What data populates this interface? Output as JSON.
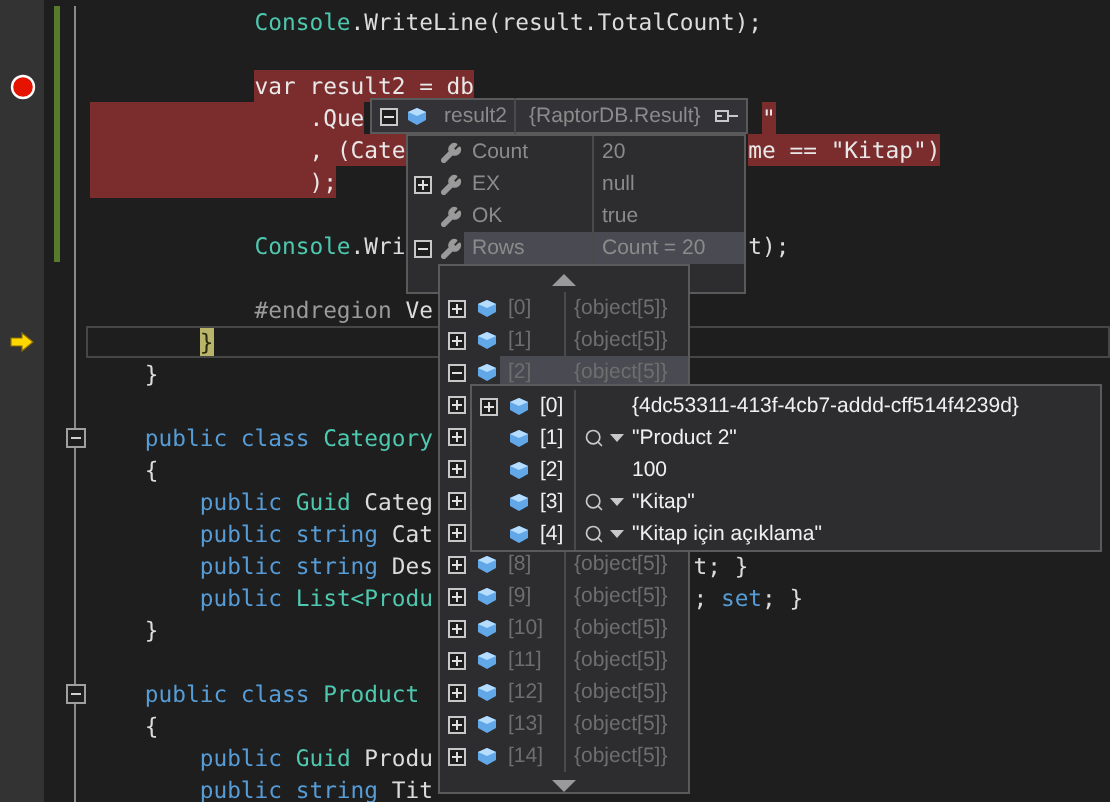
{
  "editor": {
    "lines": [
      {
        "kind": "code",
        "tokens": [
          {
            "kind": "type",
            "text": "            Console"
          },
          {
            "kind": "plain",
            "text": ".WriteLine(result.TotalCount);"
          }
        ],
        "changed": true,
        "highlighted": false
      },
      {
        "kind": "code",
        "changed": true
      },
      {
        "kind": "breakpoint",
        "tokens": [
          {
            "kind": "keyword",
            "text": "            var"
          },
          {
            "kind": "plain",
            "text": " result2 = db"
          }
        ],
        "changed": true,
        "highlighted": true
      },
      {
        "kind": "code",
        "tokens": [
          {
            "kind": "plain",
            "text": "                .Que"
          }
        ],
        "tail": [
          {
            "kind": "string",
            "text": "\""
          }
        ],
        "changed": true,
        "highlighted": true
      },
      {
        "kind": "code",
        "tokens": [
          {
            "kind": "plain",
            "text": "                , (Cate"
          }
        ],
        "tail": [
          {
            "kind": "plain",
            "text": "me == "
          },
          {
            "kind": "string",
            "text": "\"Kitap\""
          },
          {
            "kind": "plain",
            "text": ")"
          }
        ],
        "changed": true,
        "highlighted": true
      },
      {
        "kind": "code",
        "tokens": [
          {
            "kind": "plain",
            "text": "                );"
          }
        ],
        "changed": true,
        "highlighted": true
      },
      {
        "kind": "code",
        "changed": true
      },
      {
        "kind": "code",
        "tokens": [
          {
            "kind": "type",
            "text": "            Console"
          },
          {
            "kind": "plain",
            "text": ".Wri"
          }
        ],
        "tail": [
          {
            "kind": "plain",
            "text": "t);"
          }
        ],
        "changed": true,
        "highlighted": false
      },
      {
        "kind": "code"
      },
      {
        "kind": "code",
        "tokens": [
          {
            "kind": "preproc",
            "text": "            #endregion"
          },
          {
            "kind": "plain",
            "text": " Ve"
          }
        ],
        "highlighted": false
      },
      {
        "kind": "current",
        "tokens": [
          {
            "kind": "brace",
            "text": "        }"
          }
        ],
        "highlighted": false
      },
      {
        "kind": "code",
        "tokens": [
          {
            "kind": "plain",
            "text": "    }"
          }
        ],
        "highlighted": false
      },
      {
        "kind": "code"
      },
      {
        "kind": "code",
        "tokens": [
          {
            "kind": "keyword",
            "text": "    public class"
          },
          {
            "kind": "type",
            "text": " Category"
          }
        ],
        "highlighted": false,
        "fold": {
          "expanded": true
        }
      },
      {
        "kind": "code",
        "tokens": [
          {
            "kind": "plain",
            "text": "    {"
          }
        ],
        "highlighted": false
      },
      {
        "kind": "code",
        "tokens": [
          {
            "kind": "keyword",
            "text": "        public"
          },
          {
            "kind": "type",
            "text": " Guid"
          },
          {
            "kind": "plain",
            "text": " Categ"
          }
        ],
        "highlighted": false
      },
      {
        "kind": "code",
        "tokens": [
          {
            "kind": "keyword",
            "text": "        public string"
          },
          {
            "kind": "plain",
            "text": " Cat"
          }
        ],
        "highlighted": false
      },
      {
        "kind": "code",
        "tokens": [
          {
            "kind": "keyword",
            "text": "        public string"
          },
          {
            "kind": "plain",
            "text": " Des"
          }
        ],
        "tail": [
          {
            "kind": "plain",
            "text": "t; }"
          }
        ],
        "highlighted": false
      },
      {
        "kind": "code",
        "tokens": [
          {
            "kind": "keyword",
            "text": "        public"
          },
          {
            "kind": "type",
            "text": " List<Produ"
          }
        ],
        "tail": [
          {
            "kind": "plain",
            "text": "; "
          },
          {
            "kind": "keyword",
            "text": "set"
          },
          {
            "kind": "plain",
            "text": "; }"
          }
        ],
        "highlighted": false
      },
      {
        "kind": "code",
        "tokens": [
          {
            "kind": "plain",
            "text": "    }"
          }
        ],
        "highlighted": false
      },
      {
        "kind": "code"
      },
      {
        "kind": "code",
        "tokens": [
          {
            "kind": "keyword",
            "text": "    public class"
          },
          {
            "kind": "type",
            "text": " Product"
          }
        ],
        "highlighted": false,
        "fold": {
          "expanded": true
        }
      },
      {
        "kind": "code",
        "tokens": [
          {
            "kind": "plain",
            "text": "    {"
          }
        ],
        "highlighted": false
      },
      {
        "kind": "code",
        "tokens": [
          {
            "kind": "keyword",
            "text": "        public"
          },
          {
            "kind": "type",
            "text": " Guid"
          },
          {
            "kind": "plain",
            "text": " Produ"
          }
        ],
        "highlighted": false
      },
      {
        "kind": "code",
        "tokens": [
          {
            "kind": "keyword",
            "text": "        public string"
          },
          {
            "kind": "plain",
            "text": " Tit"
          }
        ],
        "highlighted": false
      }
    ]
  },
  "datatip": {
    "name": "result2",
    "type": "{RaptorDB.Result}",
    "expanded": true,
    "rows": [
      {
        "name": "Count",
        "value": "20",
        "kind": "leaf",
        "selected": false
      },
      {
        "name": "EX",
        "value": "null",
        "kind": "expandable",
        "expanded": false,
        "selected": false
      },
      {
        "name": "OK",
        "value": "true",
        "kind": "leaf",
        "selected": false
      },
      {
        "name": "Rows",
        "value": "Count = 20",
        "kind": "expandable",
        "expanded": true,
        "selected": true
      }
    ]
  },
  "rows_datatip": {
    "items": [
      {
        "index": "[0]",
        "value": "{object[5]}",
        "expanded": false,
        "selected": false
      },
      {
        "index": "[1]",
        "value": "{object[5]}",
        "expanded": false,
        "selected": false
      },
      {
        "index": "[2]",
        "value": "{object[5]}",
        "expanded": true,
        "selected": true
      },
      {
        "expanded": false
      },
      {
        "expanded": false
      },
      {
        "expanded": false
      },
      {
        "expanded": false
      },
      {
        "expanded": false
      },
      {
        "index": "[8]",
        "value": "{object[5]}",
        "expanded": false,
        "selected": false
      },
      {
        "index": "[9]",
        "value": "{object[5]}",
        "expanded": false,
        "selected": false
      },
      {
        "index": "[10]",
        "value": "{object[5]}",
        "expanded": false,
        "selected": false
      },
      {
        "index": "[11]",
        "value": "{object[5]}",
        "expanded": false,
        "selected": false
      },
      {
        "index": "[12]",
        "value": "{object[5]}",
        "expanded": false,
        "selected": false
      },
      {
        "index": "[13]",
        "value": "{object[5]}",
        "expanded": false,
        "selected": false
      },
      {
        "index": "[14]",
        "value": "{object[5]}",
        "expanded": false,
        "selected": false
      }
    ]
  },
  "item_datatip": {
    "items": [
      {
        "index": "[0]",
        "value": "{4dc53311-413f-4cb7-addd-cff514f4239d}",
        "kind": "object",
        "expanded": false
      },
      {
        "index": "[1]",
        "value": "\"Product 2\"",
        "kind": "string"
      },
      {
        "index": "[2]",
        "value": "100",
        "kind": "number"
      },
      {
        "index": "[3]",
        "value": "\"Kitap\"",
        "kind": "string"
      },
      {
        "index": "[4]",
        "value": "\"Kitap için açıklama\"",
        "kind": "string"
      }
    ]
  }
}
